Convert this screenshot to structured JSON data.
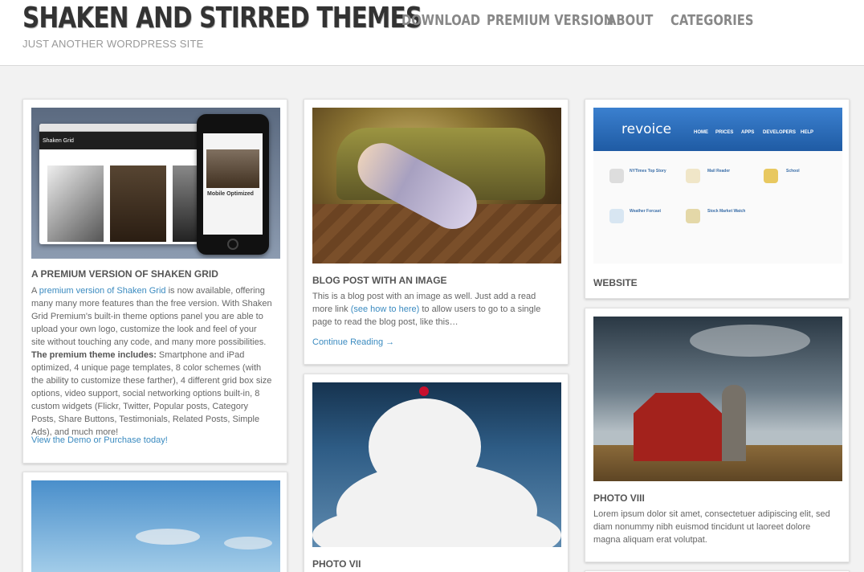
{
  "site": {
    "title": "SHAKEN AND STIRRED THEMES",
    "tagline": "JUST ANOTHER WORDPRESS SITE"
  },
  "nav": [
    "DOWNLOAD",
    "PREMIUM VERSION",
    "ABOUT",
    "CATEGORIES"
  ],
  "mockup": {
    "window_title": "Shaken Grid",
    "phone_caption": "Mobile Optimized"
  },
  "revoice": {
    "logo": "revoice",
    "nav": [
      "HOME",
      "PRICES",
      "APPS",
      "DEVELOPERS",
      "HELP"
    ],
    "apps": [
      "NYTimes Top Story",
      "Mail Reader",
      "School",
      "Weather Forcast",
      "Stock Market Watch"
    ]
  },
  "posts": {
    "premium": {
      "title": "A PREMIUM VERSION OF SHAKEN GRID",
      "intro": "A ",
      "intro_link": "premium version of Shaken Grid",
      "body1": " is now available, offering many many more features than the free version. With Shaken Grid Premium's built-in theme options panel you are able to upload your own logo, customize the look and feel of your site without touching any code, and many more possibilities. ",
      "bold": "The premium theme includes:",
      "body2": " Smartphone and iPad optimized, 4 unique page templates, 8 color schemes (with the ability to customize these farther), 4 different grid box size options, video support, social networking options built-in, 8 custom widgets (Flickr, Twitter, Popular posts, Category Posts, Share Buttons, Testimonials, Related Posts, Simple Ads), and much more!",
      "cta": "View the Demo or Purchase today!"
    },
    "image_post": {
      "title": "BLOG POST WITH AN IMAGE",
      "body1": "This is a blog post with an image as well. Just add a read more link ",
      "link": "(see how to here)",
      "body2": " to allow users to go to a single page to read the blog post, like this…",
      "more": "Continue Reading →"
    },
    "website": {
      "title": "WEBSITE"
    },
    "photo7": {
      "title": "PHOTO VII"
    },
    "photo8": {
      "title": "PHOTO VIII",
      "body": "Lorem ipsum dolor sit amet, consectetuer adipiscing elit, sed diam nonummy nibh euismod tincidunt ut laoreet dolore magna aliquam erat volutpat."
    }
  }
}
